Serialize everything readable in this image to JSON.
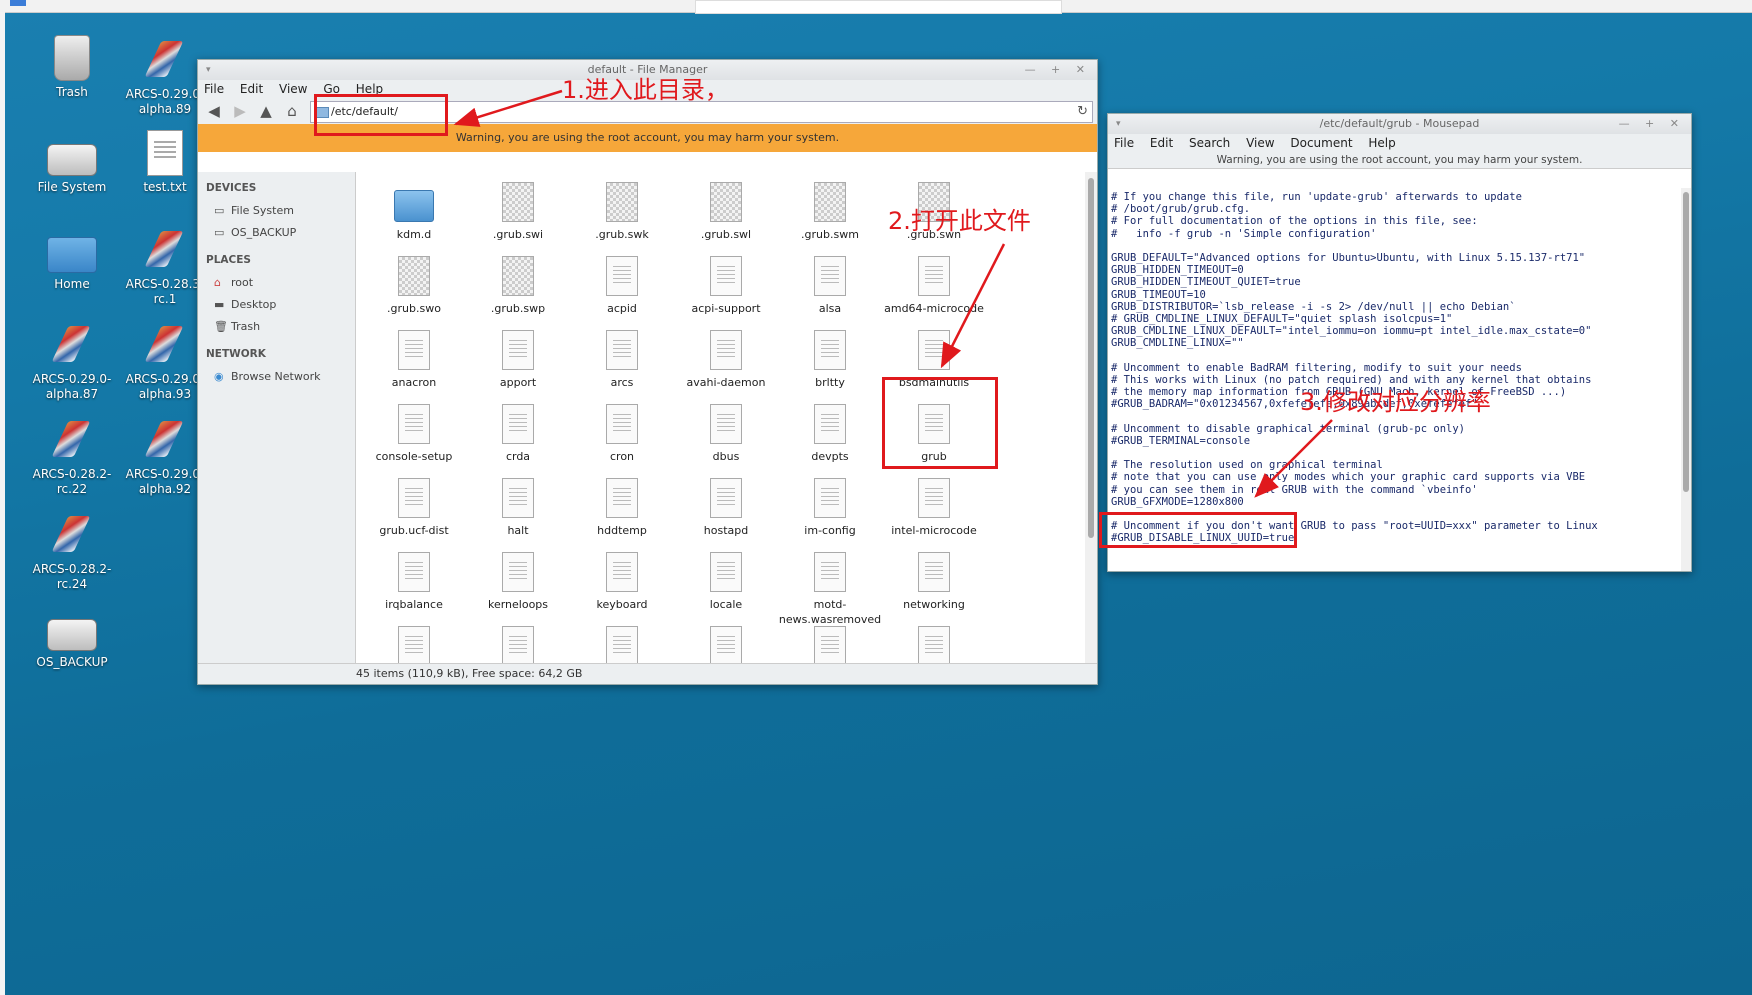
{
  "desktop": {
    "icons": [
      {
        "label": "Trash"
      },
      {
        "label": "ARCS-0.29.0-alpha.89"
      },
      {
        "label": "File System"
      },
      {
        "label": "test.txt"
      },
      {
        "label": "Home"
      },
      {
        "label": "ARCS-0.28.3-rc.1"
      },
      {
        "label": "ARCS-0.29.0-alpha.87"
      },
      {
        "label": "ARCS-0.29.0-alpha.93"
      },
      {
        "label": "ARCS-0.28.2-rc.22"
      },
      {
        "label": "ARCS-0.29.0-alpha.92"
      },
      {
        "label": "ARCS-0.28.2-rc.24"
      },
      {
        "label": "OS_BACKUP"
      }
    ]
  },
  "file_manager": {
    "title": "default - File Manager",
    "menu": [
      "File",
      "Edit",
      "View",
      "Go",
      "Help"
    ],
    "path": "/etc/default/",
    "warning": "Warning, you are using the root account, you may harm your system.",
    "sidebar": {
      "devices_header": "DEVICES",
      "devices": [
        "File System",
        "OS_BACKUP"
      ],
      "places_header": "PLACES",
      "places": [
        "root",
        "Desktop",
        "Trash"
      ],
      "network_header": "NETWORK",
      "network": [
        "Browse Network"
      ]
    },
    "files": [
      "kdm.d",
      ".grub.swi",
      ".grub.swk",
      ".grub.swl",
      ".grub.swm",
      ".grub.swn",
      ".grub.swo",
      ".grub.swp",
      "acpid",
      "acpi-support",
      "alsa",
      "amd64-microcode",
      "anacron",
      "apport",
      "arcs",
      "avahi-daemon",
      "brltty",
      "bsdmainutils",
      "console-setup",
      "crda",
      "cron",
      "dbus",
      "devpts",
      "grub",
      "grub.ucf-dist",
      "halt",
      "hddtemp",
      "hostapd",
      "im-config",
      "intel-microcode",
      "irqbalance",
      "kerneloops",
      "keyboard",
      "locale",
      "motd-news.wasremoved",
      "networking"
    ],
    "status": "45 items (110,9 kB), Free space: 64,2 GB"
  },
  "mousepad": {
    "title": "/etc/default/grub - Mousepad",
    "menu": [
      "File",
      "Edit",
      "Search",
      "View",
      "Document",
      "Help"
    ],
    "warning": "Warning, you are using the root account, you may harm your system.",
    "lines": [
      "# If you change this file, run 'update-grub' afterwards to update",
      "# /boot/grub/grub.cfg.",
      "# For full documentation of the options in this file, see:",
      "#   info -f grub -n 'Simple configuration'",
      "",
      "GRUB_DEFAULT=\"Advanced options for Ubuntu>Ubuntu, with Linux 5.15.137-rt71\"",
      "GRUB_HIDDEN_TIMEOUT=0",
      "GRUB_HIDDEN_TIMEOUT_QUIET=true",
      "GRUB_TIMEOUT=10",
      "GRUB_DISTRIBUTOR=`lsb_release -i -s 2> /dev/null || echo Debian`",
      "# GRUB_CMDLINE_LINUX_DEFAULT=\"quiet splash isolcpus=1\"",
      "GRUB_CMDLINE_LINUX_DEFAULT=\"intel_iommu=on iommu=pt intel_idle.max_cstate=0\"",
      "GRUB_CMDLINE_LINUX=\"\"",
      "",
      "# Uncomment to enable BadRAM filtering, modify to suit your needs",
      "# This works with Linux (no patch required) and with any kernel that obtains",
      "# the memory map information from GRUB (GNU Mach, kernel of FreeBSD ...)",
      "#GRUB_BADRAM=\"0x01234567,0xfefefefe,0x89abcdef,0xefefefef\"",
      "",
      "# Uncomment to disable graphical terminal (grub-pc only)",
      "#GRUB_TERMINAL=console",
      "",
      "# The resolution used on graphical terminal",
      "# note that you can use only modes which your graphic card supports via VBE",
      "# you can see them in real GRUB with the command `vbeinfo'",
      "GRUB_GFXMODE=1280x800",
      "",
      "# Uncomment if you don't want GRUB to pass \"root=UUID=xxx\" parameter to Linux",
      "#GRUB_DISABLE_LINUX_UUID=true"
    ]
  },
  "annotations": {
    "step1": "1.进入此目录，",
    "step2": "2.打开此文件",
    "step3": "3.修改对应分辨率"
  },
  "colors": {
    "annotation": "#e0191d",
    "warning_bar": "#f6a73a"
  }
}
